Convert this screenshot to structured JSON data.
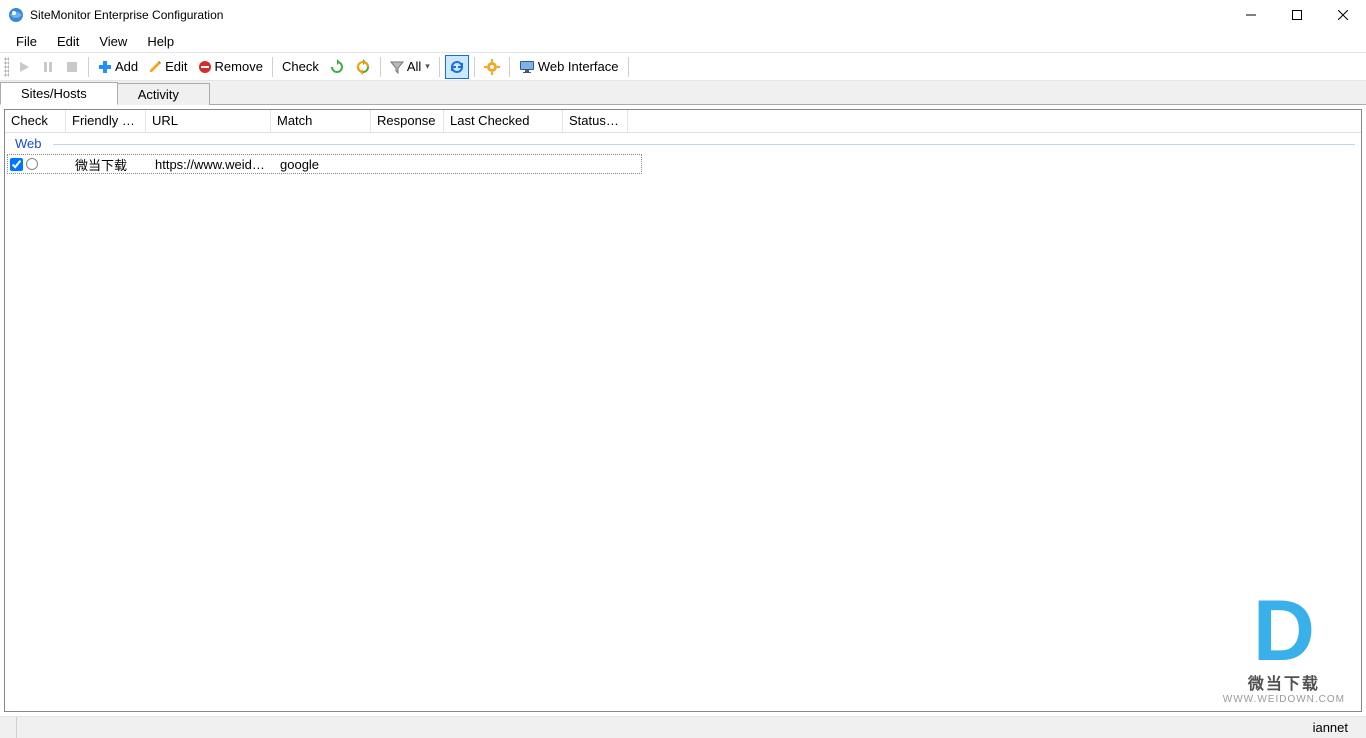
{
  "window": {
    "title": "SiteMonitor Enterprise Configuration"
  },
  "menu": {
    "file": "File",
    "edit": "Edit",
    "view": "View",
    "help": "Help"
  },
  "toolbar": {
    "add": "Add",
    "edit": "Edit",
    "remove": "Remove",
    "check": "Check",
    "all": "All",
    "web_interface": "Web Interface"
  },
  "tabs": {
    "sites": "Sites/Hosts",
    "activity": "Activity"
  },
  "columns": {
    "check": "Check",
    "friendly_name": "Friendly Na…",
    "url": "URL",
    "match": "Match",
    "response": "Response",
    "last_checked": "Last Checked",
    "status_code": "Status Co…"
  },
  "group": {
    "web": "Web"
  },
  "rows": [
    {
      "checked": true,
      "friendly_name": "微当下载",
      "url": "https://www.weido…",
      "match": "google",
      "response": "",
      "last_checked": "",
      "status_code": ""
    }
  ],
  "status": {
    "right": "iannet"
  },
  "watermark": {
    "line1": "微当下载",
    "line2": "WWW.WEIDOWN.COM"
  }
}
